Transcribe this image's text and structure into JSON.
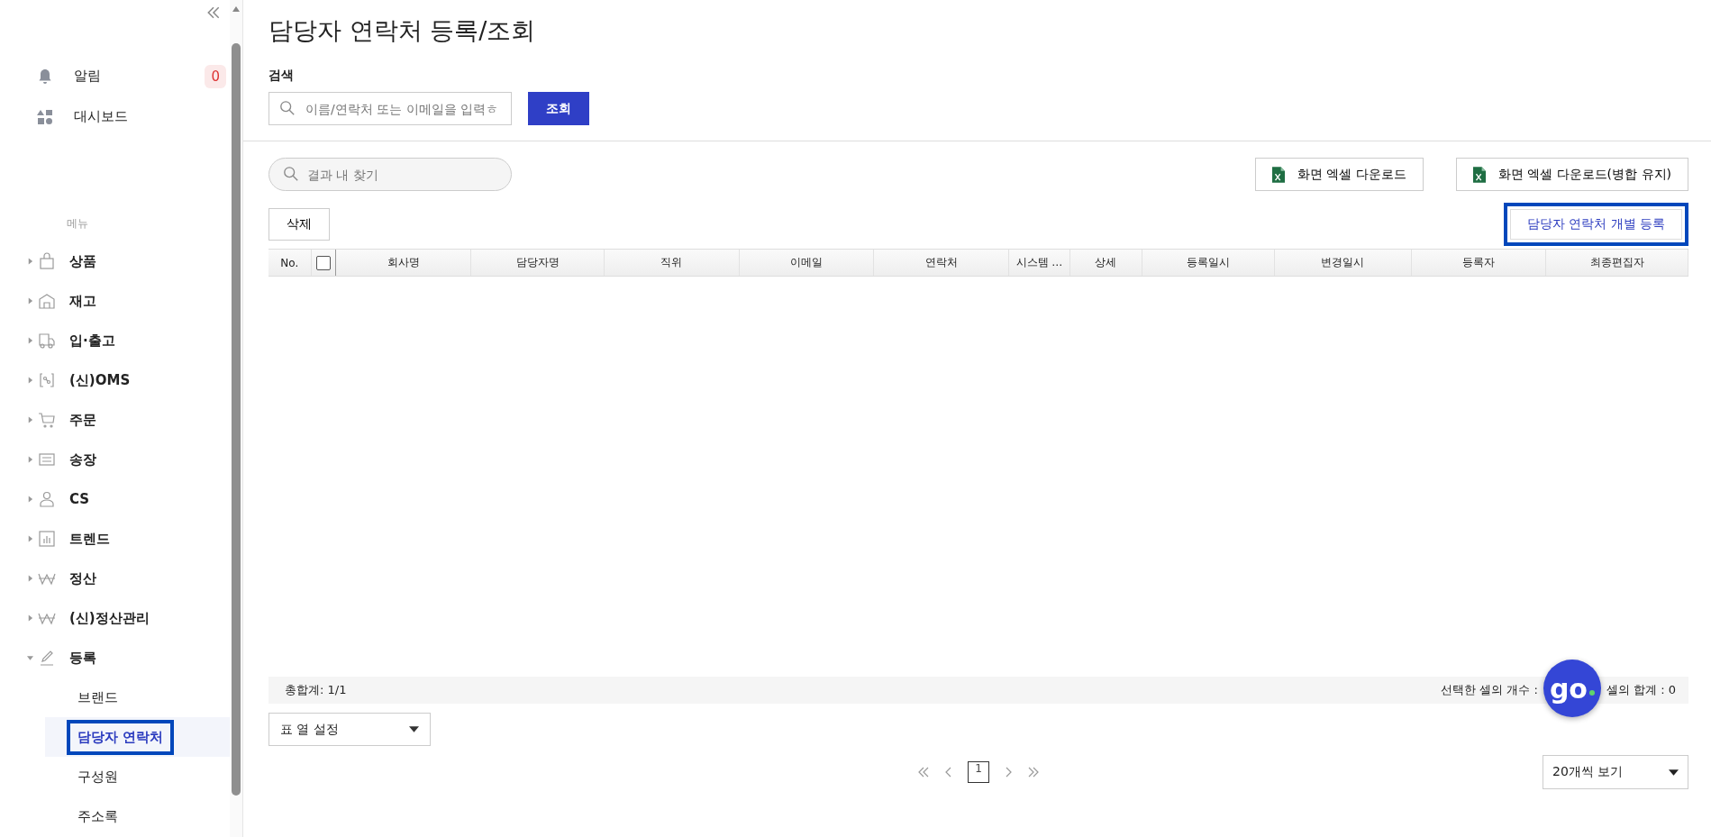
{
  "sidebar": {
    "top_items": [
      {
        "label": "알림",
        "badge": "0"
      },
      {
        "label": "대시보드"
      }
    ],
    "menu_heading": "메뉴",
    "menu": [
      {
        "label": "상품",
        "expanded": false
      },
      {
        "label": "재고",
        "expanded": false
      },
      {
        "label": "입·출고",
        "expanded": false
      },
      {
        "label": "(신)OMS",
        "expanded": false
      },
      {
        "label": "주문",
        "expanded": false
      },
      {
        "label": "송장",
        "expanded": false
      },
      {
        "label": "CS",
        "expanded": false
      },
      {
        "label": "트렌드",
        "expanded": false
      },
      {
        "label": "정산",
        "expanded": false
      },
      {
        "label": "(신)정산관리",
        "expanded": false
      },
      {
        "label": "등록",
        "expanded": true,
        "children": [
          {
            "label": "브랜드",
            "selected": false
          },
          {
            "label": "담당자 연락처",
            "selected": true
          },
          {
            "label": "구성원",
            "selected": false
          },
          {
            "label": "주소록",
            "selected": false
          }
        ]
      }
    ]
  },
  "page_title": "담당자 연락처 등록/조회",
  "search": {
    "label": "검색",
    "placeholder": "이름/연락처 또는 이메일을 입력ㅎ",
    "button": "조회"
  },
  "result_search": {
    "placeholder": "결과 내 찾기"
  },
  "excel_buttons": [
    "화면 엑셀 다운로드",
    "화면 엑셀 다운로드(병합 유지)"
  ],
  "delete_button": "삭제",
  "register_button": {
    "label": "담당자 연락처 개별 등록",
    "highlighted": true
  },
  "table": {
    "select_all_checked": false,
    "columns": [
      "No.",
      "회사명",
      "담당자명",
      "직위",
      "이메일",
      "연락처",
      "시스템 …",
      "상세",
      "등록일시",
      "변경일시",
      "등록자",
      "최종편집자"
    ]
  },
  "summary": {
    "total": "총합계: 1/1",
    "selected_count": "선택한 셀의 개수 :",
    "selected_sum": "셀의 합계 : 0"
  },
  "column_settings": "표 열 설정",
  "pagination": {
    "pages": [
      {
        "label": "1",
        "selected": true
      }
    ],
    "page_size": "20개씩 보기"
  },
  "chat_button": "go"
}
